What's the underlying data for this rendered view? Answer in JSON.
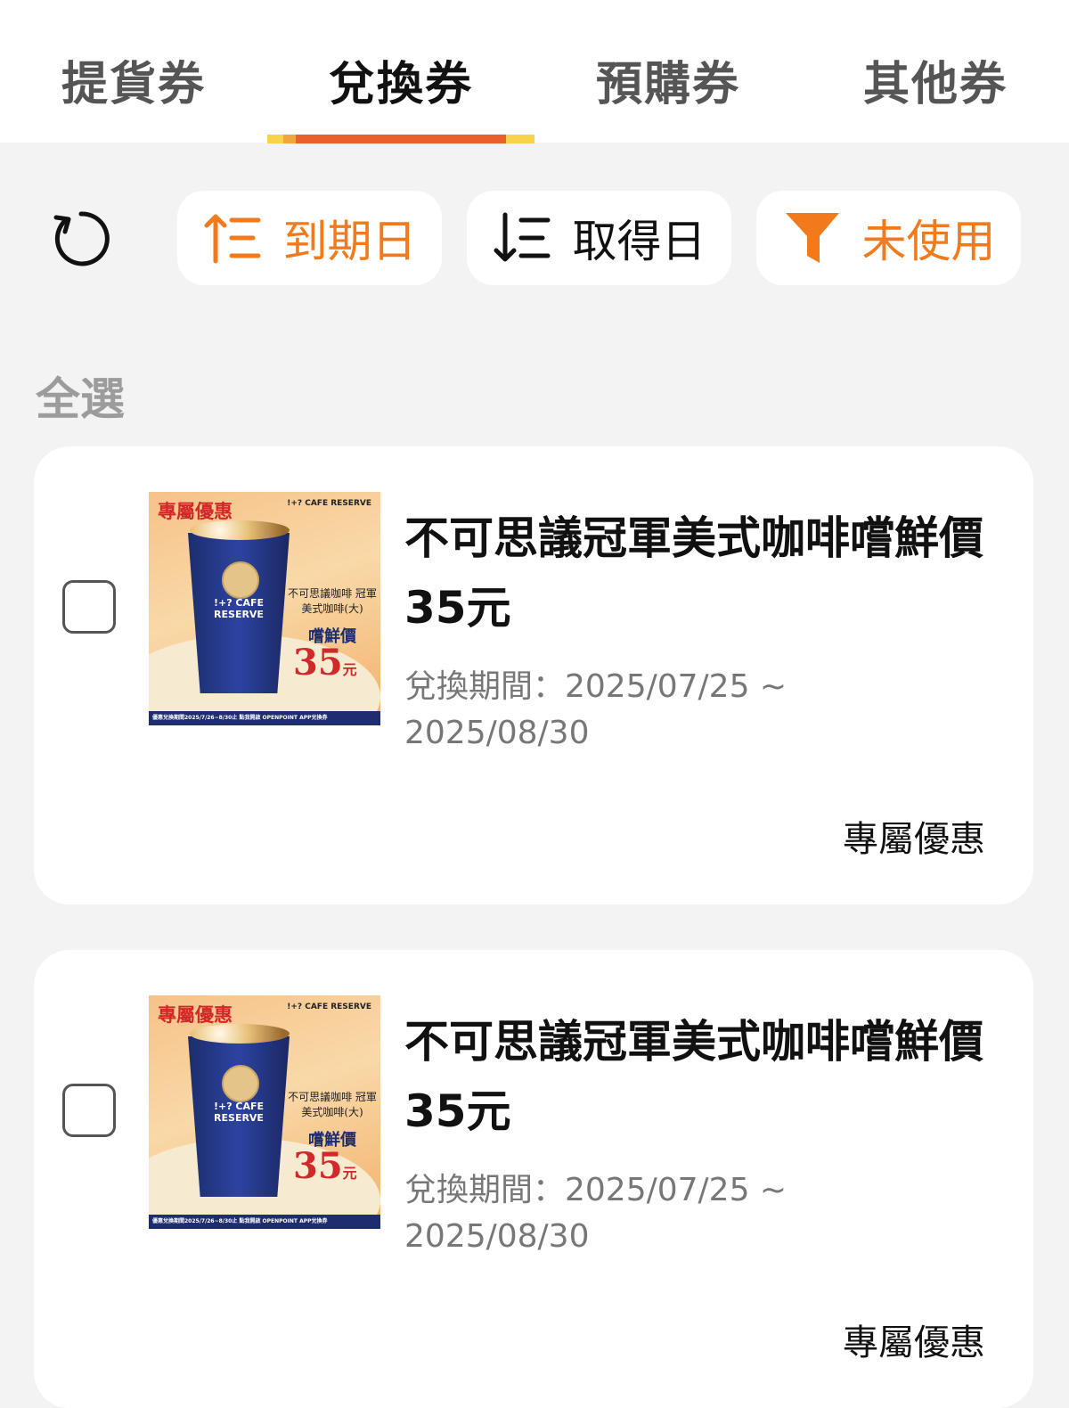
{
  "tabs": [
    {
      "label": "提貨券",
      "active": false
    },
    {
      "label": "兌換券",
      "active": true
    },
    {
      "label": "預購券",
      "active": false
    },
    {
      "label": "其他券",
      "active": false
    }
  ],
  "filters": {
    "refresh_icon": "refresh-icon",
    "expiry": {
      "label": "到期日",
      "icon": "sort-ascending-icon",
      "color": "#f17a1c"
    },
    "acquired": {
      "label": "取得日",
      "icon": "sort-descending-icon",
      "color": "#111111"
    },
    "status": {
      "label": "未使用",
      "icon": "filter-funnel-icon",
      "color": "#f17a1c"
    }
  },
  "select_all": "全選",
  "coupons": [
    {
      "title": "不可思議冠軍美式咖啡嚐鮮價35元",
      "period": "兌換期間：2025/07/25 ~ 2025/08/30",
      "badge": "專屬優惠",
      "checked": false,
      "image": {
        "tag": "專屬優惠",
        "brand": "!+? CAFE RESERVE",
        "cup_text": "!+? CAFE RESERVE",
        "desc": "不可思議咖啡 冠軍美式咖啡(大)",
        "subprice": "嚐鮮價",
        "price": "35",
        "price_unit": "元",
        "footer": "優惠兌換期間2025/7/26~8/30止 點我開啟 OPENPOINT APP兌換券"
      }
    },
    {
      "title": "不可思議冠軍美式咖啡嚐鮮價35元",
      "period": "兌換期間：2025/07/25 ~ 2025/08/30",
      "badge": "專屬優惠",
      "checked": false,
      "image": {
        "tag": "專屬優惠",
        "brand": "!+? CAFE RESERVE",
        "cup_text": "!+? CAFE RESERVE",
        "desc": "不可思議咖啡 冠軍美式咖啡(大)",
        "subprice": "嚐鮮價",
        "price": "35",
        "price_unit": "元",
        "footer": "優惠兌換期間2025/7/26~8/30止 點我開啟 OPENPOINT APP兌換券"
      }
    }
  ],
  "colors": {
    "accent": "#e8612c",
    "accent_yellow": "#f7d24a",
    "background": "#f3f3f3"
  }
}
